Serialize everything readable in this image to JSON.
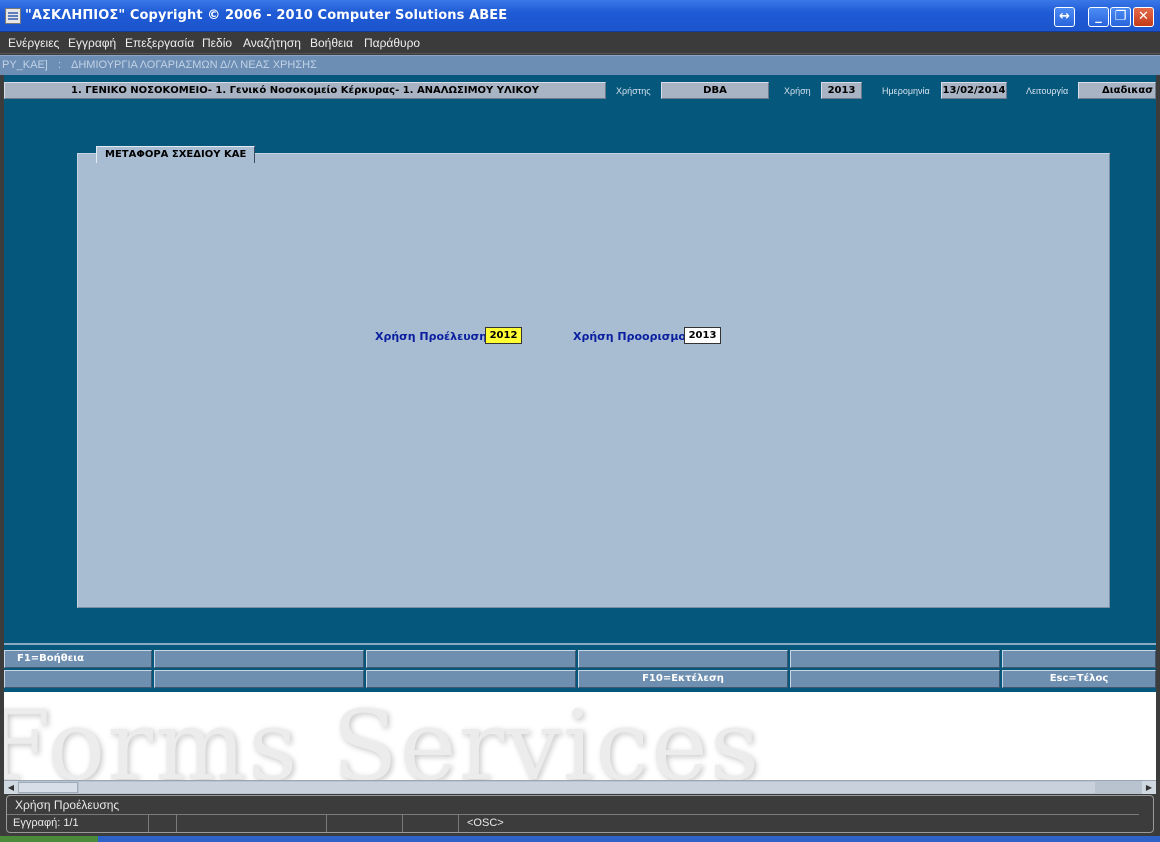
{
  "window": {
    "title": "\"ΑΣΚΛΗΠΙΟΣ\" Copyright © 2006 - 2010 Computer Solutions ΑΒΕΕ"
  },
  "menu": [
    "Ενέργειες",
    "Εγγραφή",
    "Επεξεργασία",
    "Πεδίο",
    "Αναζήτηση",
    "Βοήθεια",
    "Παράθυρο"
  ],
  "path": {
    "module": "ΡΥ_ΚΑΕ]",
    "separator": ":",
    "form_title": "ΔΗΜΙΟΥΡΓΙΑ ΛΟΓΑΡΙΑΣΜΩΝ Δ/Λ ΝΕΑΣ ΧΡΗΣΗΣ"
  },
  "info": {
    "organization": "1. ΓΕΝΙΚΟ ΝΟΣΟΚΟΜΕΙΟ- 1. Γενικό Νοσοκομείο Κέρκυρας- 1. ΑΝΑΛΩΣΙΜΟΥ ΥΛΙΚΟΥ",
    "user_label": "Χρήστης",
    "user_value": "DBA",
    "year_label": "Χρήση",
    "year_value": "2013",
    "date_label": "Ημερομηνία",
    "date_value": "13/02/2014",
    "mode_label": "Λειτουργία",
    "mode_value": "Διαδικασ"
  },
  "panel": {
    "title": "ΜΕΤΑΦΟΡΑ ΣΧΕΔΙΟΥ ΚΑΕ",
    "source_label": "Χρήση Προέλευσης",
    "source_value": "2012",
    "target_label": "Χρήση Προορισμού",
    "target_value": "2013"
  },
  "fkeys": {
    "row1": [
      "F1=Βοήθεια",
      "",
      "",
      "",
      "",
      ""
    ],
    "row2": [
      "",
      "",
      "",
      "F10=Εκτέλεση",
      "",
      "Esc=Τέλος"
    ]
  },
  "watermark": "Forms Services",
  "status": {
    "message": "Χρήση Προέλευσης",
    "record": "Εγγραφή: 1/1",
    "cell2": "",
    "cell3": "",
    "cell4": "",
    "cell5": "",
    "osc": "<OSC>"
  },
  "colors": {
    "canvas_bg": "#05577b",
    "panel_bg": "#a8bdd2",
    "label_blue": "#0a1ea0",
    "highlight_yellow": "#ffff33"
  }
}
